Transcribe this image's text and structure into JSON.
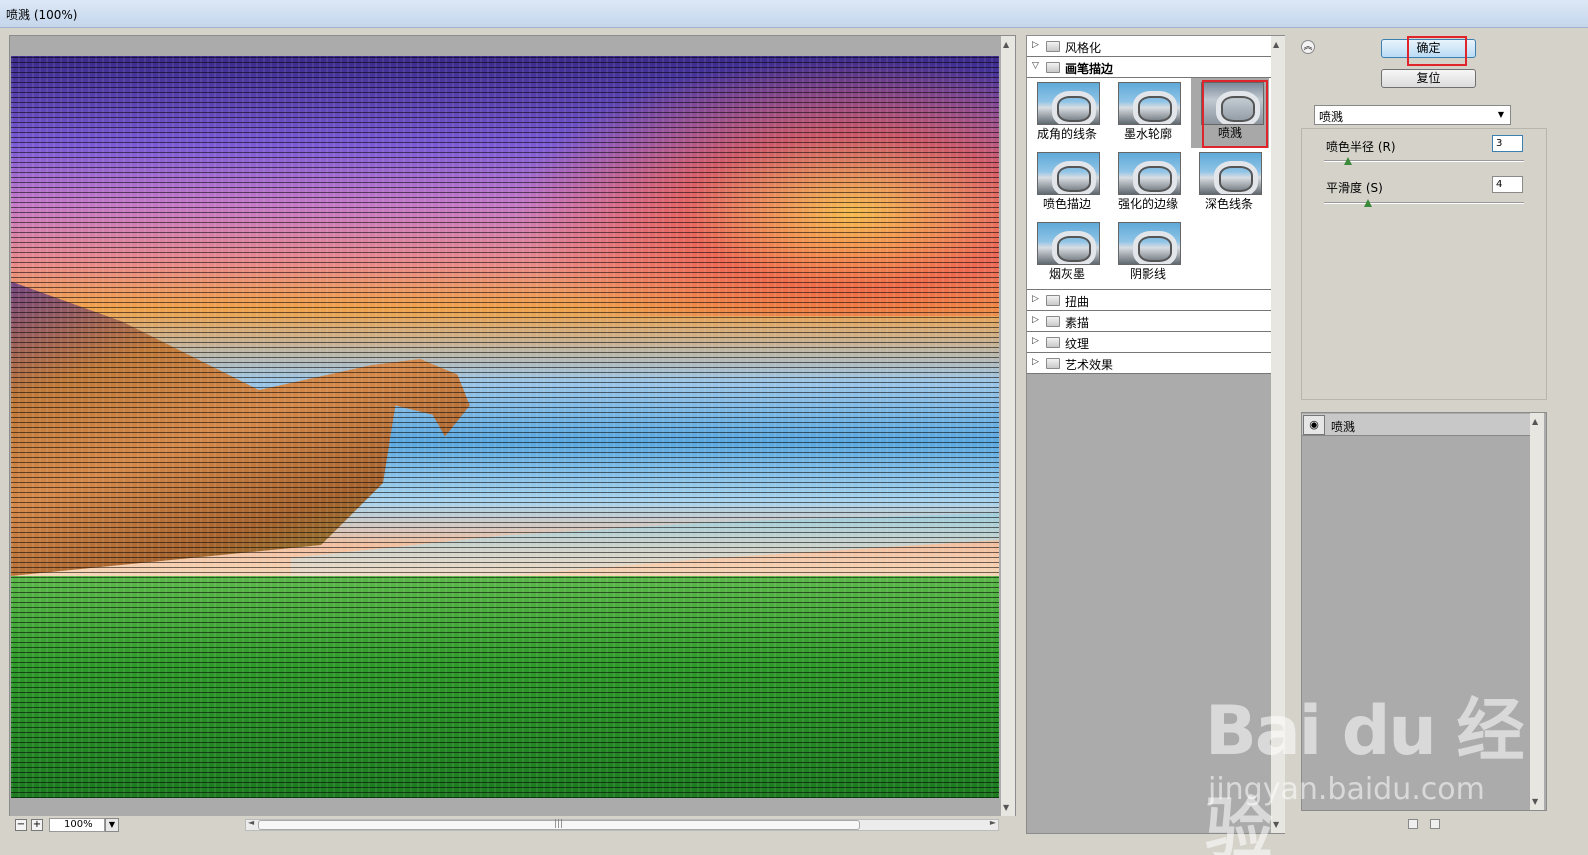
{
  "window": {
    "title": "喷溅 (100%)"
  },
  "preview": {
    "zoom_value": "100%",
    "zoom_out_icon": "minus-icon",
    "zoom_in_icon": "plus-icon"
  },
  "filter_gallery": {
    "categories_top": [
      {
        "label": "风格化",
        "expanded": false
      }
    ],
    "open_category": {
      "label": "画笔描边",
      "expanded": true
    },
    "thumbnails": [
      {
        "label": "成角的线条",
        "selected": false
      },
      {
        "label": "墨水轮廓",
        "selected": false
      },
      {
        "label": "喷溅",
        "selected": true
      },
      {
        "label": "喷色描边",
        "selected": false
      },
      {
        "label": "强化的边缘",
        "selected": false
      },
      {
        "label": "深色线条",
        "selected": false
      },
      {
        "label": "烟灰墨",
        "selected": false
      },
      {
        "label": "阴影线",
        "selected": false
      }
    ],
    "categories_bottom": [
      {
        "label": "扭曲",
        "expanded": false
      },
      {
        "label": "素描",
        "expanded": false
      },
      {
        "label": "纹理",
        "expanded": false
      },
      {
        "label": "艺术效果",
        "expanded": false
      }
    ]
  },
  "actions": {
    "ok_label": "确定",
    "reset_label": "复位"
  },
  "settings": {
    "filter_select": "喷溅",
    "params": [
      {
        "label": "喷色半径 (R)",
        "value": "3",
        "slider_fraction": 0.12
      },
      {
        "label": "平滑度 (S)",
        "value": "4",
        "slider_fraction": 0.22
      }
    ]
  },
  "layers": {
    "items": [
      {
        "name": "喷溅",
        "visible": true
      }
    ]
  },
  "watermark": {
    "brand": "Bai  du 经验",
    "url": "jingyan.baidu.com"
  },
  "colors": {
    "highlight_red": "#e0242b",
    "default_button": "#b9dbf5"
  }
}
